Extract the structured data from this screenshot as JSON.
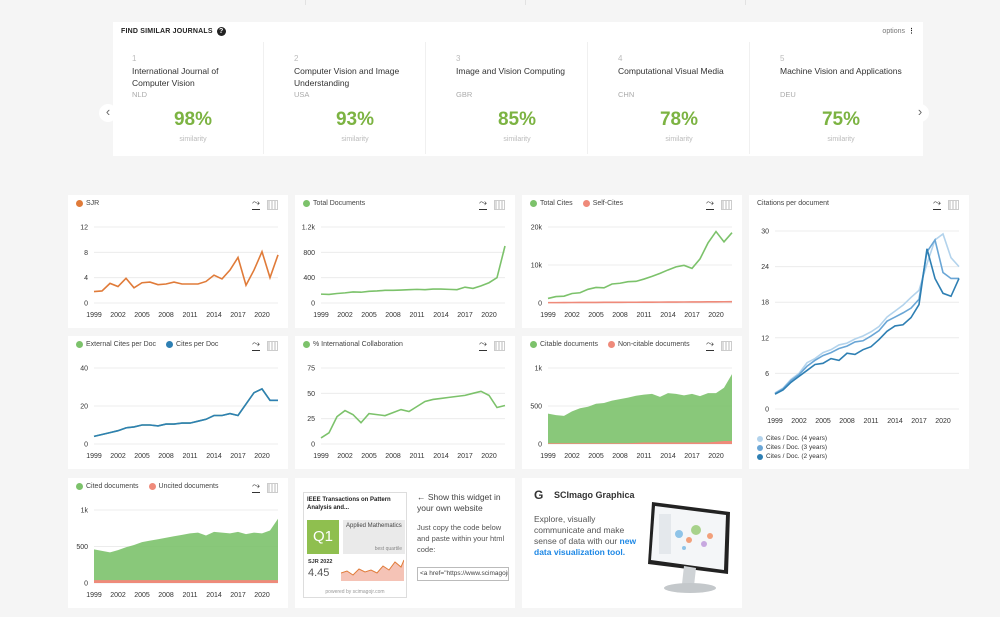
{
  "similar": {
    "title": "FIND SIMILAR JOURNALS",
    "help_icon": "?",
    "options_label": "options",
    "options_icon": "⋮",
    "similarity_label": "similarity",
    "prev_icon": "‹",
    "next_icon": "›",
    "journals": [
      {
        "rank": "1",
        "name": "International Journal of Computer Vision",
        "country": "NLD",
        "pct": "98%"
      },
      {
        "rank": "2",
        "name": "Computer Vision and Image Understanding",
        "country": "USA",
        "pct": "93%"
      },
      {
        "rank": "3",
        "name": "Image and Vision Computing",
        "country": "GBR",
        "pct": "85%"
      },
      {
        "rank": "4",
        "name": "Computational Visual Media",
        "country": "CHN",
        "pct": "78%"
      },
      {
        "rank": "5",
        "name": "Machine Vision and Applications",
        "country": "DEU",
        "pct": "75%"
      }
    ]
  },
  "colors": {
    "orange": "#e07b39",
    "green": "#7cc26b",
    "green_fill": "#78c36b",
    "red": "#ef8a7a",
    "blue": "#2e7fb3",
    "blue2": "#6aa6d6",
    "blue3": "#b3d3ec"
  },
  "charts": {
    "sjr": {
      "type": "line",
      "legend": [
        {
          "label": "SJR",
          "color": "#e07b39"
        }
      ],
      "xticks": [
        "1999",
        "2002",
        "2005",
        "2008",
        "2011",
        "2014",
        "2017",
        "2020"
      ],
      "yticks": [
        "0",
        "4",
        "8",
        "12"
      ],
      "ylim": [
        0,
        12
      ],
      "x": [
        1999,
        2000,
        2001,
        2002,
        2003,
        2004,
        2005,
        2006,
        2007,
        2008,
        2009,
        2010,
        2011,
        2012,
        2013,
        2014,
        2015,
        2016,
        2017,
        2018,
        2019,
        2020,
        2021,
        2022
      ],
      "series": [
        {
          "name": "SJR",
          "color": "#e07b39",
          "values": [
            1.8,
            1.9,
            3.1,
            2.6,
            3.9,
            2.4,
            3.2,
            3.3,
            2.9,
            3.0,
            3.3,
            3.0,
            3.0,
            3.0,
            3.4,
            4.4,
            3.8,
            5.2,
            7.2,
            2.8,
            5.2,
            8.1,
            4.0,
            7.6
          ]
        }
      ]
    },
    "total_docs": {
      "type": "line",
      "legend": [
        {
          "label": "Total Documents",
          "color": "#7cc26b"
        }
      ],
      "xticks": [
        "1999",
        "2002",
        "2005",
        "2008",
        "2011",
        "2014",
        "2017",
        "2020"
      ],
      "yticks": [
        "0",
        "400",
        "800",
        "1.2k"
      ],
      "ylim": [
        0,
        1200
      ],
      "x": [
        1999,
        2000,
        2001,
        2002,
        2003,
        2004,
        2005,
        2006,
        2007,
        2008,
        2009,
        2010,
        2011,
        2012,
        2013,
        2014,
        2015,
        2016,
        2017,
        2018,
        2019,
        2020,
        2021,
        2022
      ],
      "series": [
        {
          "name": "Total Documents",
          "color": "#7cc26b",
          "values": [
            140,
            135,
            150,
            160,
            175,
            170,
            185,
            190,
            200,
            200,
            205,
            210,
            215,
            210,
            220,
            220,
            215,
            210,
            250,
            230,
            270,
            320,
            400,
            900
          ]
        }
      ]
    },
    "total_cites": {
      "type": "line",
      "legend": [
        {
          "label": "Total Cites",
          "color": "#7cc26b"
        },
        {
          "label": "Self-Cites",
          "color": "#ef8a7a"
        }
      ],
      "xticks": [
        "1999",
        "2002",
        "2005",
        "2008",
        "2011",
        "2014",
        "2017",
        "2020"
      ],
      "yticks": [
        "0",
        "10k",
        "20k"
      ],
      "ylim": [
        0,
        20000
      ],
      "x": [
        1999,
        2000,
        2001,
        2002,
        2003,
        2004,
        2005,
        2006,
        2007,
        2008,
        2009,
        2010,
        2011,
        2012,
        2013,
        2014,
        2015,
        2016,
        2017,
        2018,
        2019,
        2020,
        2021,
        2022
      ],
      "series": [
        {
          "name": "Total Cites",
          "color": "#7cc26b",
          "values": [
            1200,
            1700,
            1800,
            2500,
            2700,
            3600,
            4100,
            4000,
            5000,
            5200,
            5600,
            5700,
            6300,
            7000,
            7800,
            8700,
            9500,
            9900,
            9100,
            11600,
            15800,
            18800,
            16100,
            18500
          ]
        },
        {
          "name": "Self-Cites",
          "color": "#ef8a7a",
          "values": [
            100,
            100,
            120,
            130,
            140,
            150,
            160,
            170,
            180,
            190,
            200,
            200,
            210,
            220,
            230,
            240,
            250,
            260,
            270,
            280,
            300,
            320,
            330,
            340
          ]
        }
      ]
    },
    "cites_per_doc": {
      "type": "line",
      "legend": [
        {
          "label": "Citations per document",
          "color": "#333333"
        }
      ],
      "xticks": [
        "1999",
        "2002",
        "2005",
        "2008",
        "2011",
        "2014",
        "2017",
        "2020"
      ],
      "yticks": [
        "0",
        "6",
        "12",
        "18",
        "24",
        "30"
      ],
      "ylim": [
        0,
        30
      ],
      "x": [
        1999,
        2000,
        2001,
        2002,
        2003,
        2004,
        2005,
        2006,
        2007,
        2008,
        2009,
        2010,
        2011,
        2012,
        2013,
        2014,
        2015,
        2016,
        2017,
        2018,
        2019,
        2020,
        2021,
        2022
      ],
      "series": [
        {
          "name": "Cites / Doc. (4 years)",
          "color": "#b3d3ec",
          "values": [
            2.7,
            3.5,
            5.0,
            6.0,
            7.8,
            8.5,
            9.5,
            10.0,
            10.8,
            11.1,
            11.8,
            12.3,
            13.0,
            13.9,
            15.5,
            16.5,
            17.5,
            18.8,
            20.0,
            24.5,
            28.5,
            29.5,
            25.5,
            24.0
          ]
        },
        {
          "name": "Cites / Doc. (3 years)",
          "color": "#6aa6d6",
          "values": [
            2.6,
            3.4,
            4.8,
            5.8,
            7.2,
            8.2,
            9.0,
            9.5,
            10.2,
            10.6,
            11.3,
            11.5,
            12.3,
            13.2,
            14.8,
            15.5,
            16.2,
            17.0,
            18.5,
            26.5,
            28.5,
            23.0,
            22.0,
            22.0
          ]
        },
        {
          "name": "Cites / Doc. (2 years)",
          "color": "#2e7fb3",
          "values": [
            2.5,
            3.2,
            4.5,
            5.5,
            6.5,
            7.5,
            7.7,
            8.5,
            8.2,
            9.4,
            9.2,
            10.0,
            10.5,
            11.7,
            13.1,
            14.0,
            14.2,
            15.4,
            17.6,
            27.0,
            22.0,
            19.5,
            19.0,
            22.0
          ]
        }
      ],
      "legend_bottom": [
        "Cites / Doc. (4 years)",
        "Cites / Doc. (3 years)",
        "Cites / Doc. (2 years)"
      ]
    },
    "external_cites": {
      "type": "line",
      "legend": [
        {
          "label": "External Cites per Doc",
          "color": "#7cc26b"
        },
        {
          "label": "Cites per Doc",
          "color": "#2e7fb3"
        }
      ],
      "xticks": [
        "1999",
        "2002",
        "2005",
        "2008",
        "2011",
        "2014",
        "2017",
        "2020"
      ],
      "yticks": [
        "0",
        "20",
        "40"
      ],
      "ylim": [
        0,
        40
      ],
      "x": [
        1999,
        2000,
        2001,
        2002,
        2003,
        2004,
        2005,
        2006,
        2007,
        2008,
        2009,
        2010,
        2011,
        2012,
        2013,
        2014,
        2015,
        2016,
        2017,
        2018,
        2019,
        2020,
        2021,
        2022
      ],
      "series": [
        {
          "name": "External Cites per Doc",
          "color": "#7cc26b",
          "values": [
            4,
            5,
            6,
            7,
            8.5,
            9,
            10,
            10,
            9.5,
            10.5,
            10.5,
            11,
            11,
            12,
            13,
            15,
            15,
            16,
            15,
            21,
            27,
            29,
            23,
            23
          ]
        },
        {
          "name": "Cites per Doc",
          "color": "#2e7fb3",
          "values": [
            4,
            5,
            6,
            7,
            8.5,
            9,
            10,
            10,
            9.5,
            10.5,
            10.5,
            11,
            11,
            12,
            13,
            15,
            15,
            16,
            15,
            21,
            27,
            29,
            23,
            23
          ]
        }
      ]
    },
    "intl_collab": {
      "type": "line",
      "legend": [
        {
          "label": "% International Collaboration",
          "color": "#7cc26b"
        }
      ],
      "xticks": [
        "1999",
        "2002",
        "2005",
        "2008",
        "2011",
        "2014",
        "2017",
        "2020"
      ],
      "yticks": [
        "0",
        "25",
        "50",
        "75"
      ],
      "ylim": [
        0,
        75
      ],
      "x": [
        1999,
        2000,
        2001,
        2002,
        2003,
        2004,
        2005,
        2006,
        2007,
        2008,
        2009,
        2010,
        2011,
        2012,
        2013,
        2014,
        2015,
        2016,
        2017,
        2018,
        2019,
        2020,
        2021,
        2022
      ],
      "series": [
        {
          "name": "% International Collaboration",
          "color": "#7cc26b",
          "values": [
            6,
            11,
            27,
            33,
            29,
            21,
            30,
            29,
            28,
            31,
            34,
            32,
            37,
            42,
            44,
            45,
            46,
            47,
            48,
            50,
            52,
            48,
            36,
            38
          ]
        }
      ]
    },
    "citable_docs": {
      "type": "area",
      "legend": [
        {
          "label": "Citable documents",
          "color": "#7cc26b"
        },
        {
          "label": "Non-citable documents",
          "color": "#ef8a7a"
        }
      ],
      "xticks": [
        "1999",
        "2002",
        "2005",
        "2008",
        "2011",
        "2014",
        "2017",
        "2020"
      ],
      "yticks": [
        "0",
        "500",
        "1k"
      ],
      "ylim": [
        0,
        1000
      ],
      "x": [
        1999,
        2000,
        2001,
        2002,
        2003,
        2004,
        2005,
        2006,
        2007,
        2008,
        2009,
        2010,
        2011,
        2012,
        2013,
        2014,
        2015,
        2016,
        2017,
        2018,
        2019,
        2020,
        2021,
        2022
      ],
      "series": [
        {
          "name": "Non-citable documents",
          "color": "#ef8a7a",
          "values": [
            10,
            10,
            10,
            10,
            10,
            10,
            10,
            10,
            10,
            10,
            10,
            15,
            20,
            20,
            20,
            20,
            20,
            20,
            20,
            20,
            20,
            30,
            40,
            40
          ]
        },
        {
          "name": "Citable documents",
          "color": "#7cc26b",
          "values": [
            390,
            370,
            360,
            420,
            460,
            480,
            520,
            530,
            560,
            580,
            600,
            620,
            630,
            640,
            600,
            650,
            640,
            620,
            640,
            610,
            650,
            640,
            700,
            880
          ]
        }
      ]
    },
    "cited_docs": {
      "type": "area",
      "legend": [
        {
          "label": "Cited documents",
          "color": "#7cc26b"
        },
        {
          "label": "Uncited documents",
          "color": "#ef8a7a"
        }
      ],
      "xticks": [
        "1999",
        "2002",
        "2005",
        "2008",
        "2011",
        "2014",
        "2017",
        "2020"
      ],
      "yticks": [
        "0",
        "500",
        "1k"
      ],
      "ylim": [
        0,
        1000
      ],
      "x": [
        1999,
        2000,
        2001,
        2002,
        2003,
        2004,
        2005,
        2006,
        2007,
        2008,
        2009,
        2010,
        2011,
        2012,
        2013,
        2014,
        2015,
        2016,
        2017,
        2018,
        2019,
        2020,
        2021,
        2022
      ],
      "series": [
        {
          "name": "Uncited documents",
          "color": "#ef8a7a",
          "values": [
            40,
            40,
            40,
            40,
            40,
            40,
            40,
            40,
            40,
            40,
            40,
            40,
            40,
            40,
            40,
            40,
            40,
            40,
            40,
            40,
            40,
            40,
            40,
            40
          ]
        },
        {
          "name": "Cited documents",
          "color": "#7cc26b",
          "values": [
            420,
            400,
            380,
            410,
            450,
            480,
            520,
            540,
            560,
            580,
            600,
            620,
            640,
            650,
            610,
            660,
            650,
            640,
            660,
            630,
            650,
            640,
            680,
            840
          ]
        }
      ]
    }
  },
  "widget": {
    "journal": "IEEE Transactions on Pattern Analysis and...",
    "quartile": "Q1",
    "category": "Applied Mathematics",
    "quartile_label": "best quartile",
    "sjr_label": "SJR 2022",
    "sjr_value": "4.45",
    "powered": "powered by scimagojr.com",
    "show_text": "← Show this widget in your own website",
    "copy_text": "Just copy the code below and paste within your html code:",
    "code_value": "<a href=\"https://www.scimagojr.com/journalsearch.php?q=..."
  },
  "graphica": {
    "logo": "G",
    "title": "SCImago Graphica",
    "text": "Explore, visually communicate and make sense of data with our",
    "link": "new data visualization tool."
  }
}
